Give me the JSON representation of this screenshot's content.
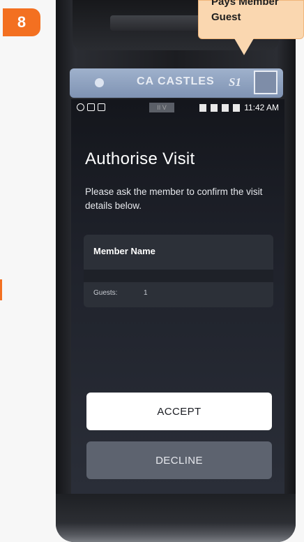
{
  "step": {
    "number": "8"
  },
  "callout": {
    "line1": "Pays Member",
    "line2": "Guest"
  },
  "device": {
    "brand": "CASTLES",
    "brand_prefix": "CA",
    "model": "S1"
  },
  "status_bar": {
    "center_text": "II V",
    "time": "11:42 AM"
  },
  "screen": {
    "title": "Authorise Visit",
    "subtitle": "Please ask the member to confirm the visit details below.",
    "card": {
      "member_name": "Member Name",
      "guests_label": "Guests:",
      "guests_value": "1"
    },
    "accept_label": "ACCEPT",
    "decline_label": "DECLINE"
  },
  "colors": {
    "accent": "#f37021",
    "callout_bg": "#fad7b0",
    "screen_bg": "#1f222b",
    "accept_bg": "#ffffff",
    "decline_bg": "#5d636f"
  },
  "icons": [
    "eye-icon",
    "sim-icon",
    "card-icon",
    "nfc-icon",
    "wifi-icon",
    "signal-icon",
    "battery-icon"
  ]
}
